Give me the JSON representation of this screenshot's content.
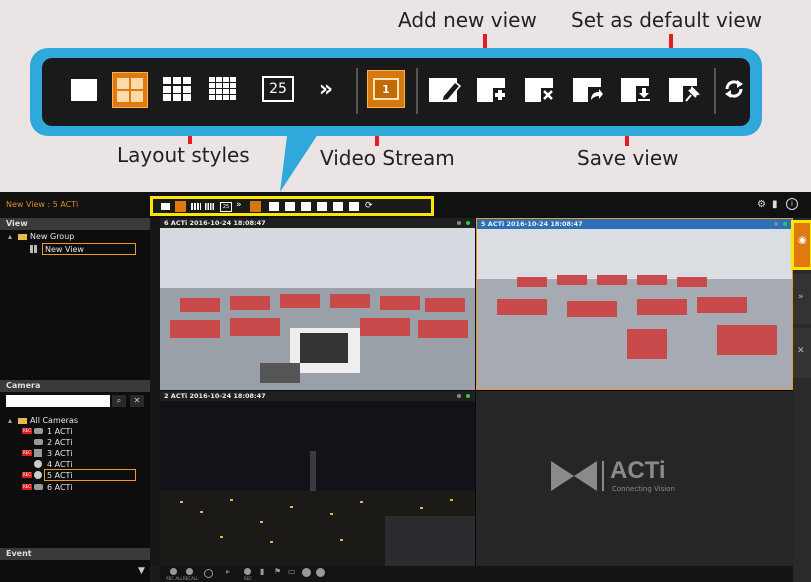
{
  "callouts": {
    "add_new_view": "Add new view",
    "set_default_view": "Set as default view",
    "layout_styles": "Layout styles",
    "video_stream": "Video Stream",
    "save_view": "Save view"
  },
  "toolbar": {
    "layout_25_label": "25",
    "more_symbol": "»",
    "stream_label": "1"
  },
  "app": {
    "title": "New View : 5 ACTi",
    "view_section": "View",
    "group_name": "New Group",
    "view_name": "New View",
    "camera_section": "Camera",
    "search_placeholder": "",
    "all_cameras": "All Cameras",
    "cameras": [
      "1 ACTi",
      "2 ACTi",
      "3 ACTi",
      "4 ACTi",
      "5 ACTi",
      "6 ACTi"
    ],
    "rec_badge": "REC",
    "event_section": "Event",
    "tiles": [
      {
        "label": "6 ACTi  2016-10-24 18:08:47"
      },
      {
        "label": "5 ACTi  2016-10-24 18:08:47"
      },
      {
        "label": "2 ACTi  2016-10-24 18:08:47"
      }
    ],
    "logo_text": "ACTi",
    "logo_sub": "Connecting Vision",
    "bottom": {
      "rec_all": "REC ALL",
      "recall": "RECALL",
      "rec": "REC"
    }
  },
  "colors": {
    "accent_orange": "#f08b1a",
    "callout_blue": "#2fa8dc",
    "highlight_yellow": "#ffe600",
    "arrow_red": "#e41d24",
    "selected_border": "#e89b2a"
  }
}
